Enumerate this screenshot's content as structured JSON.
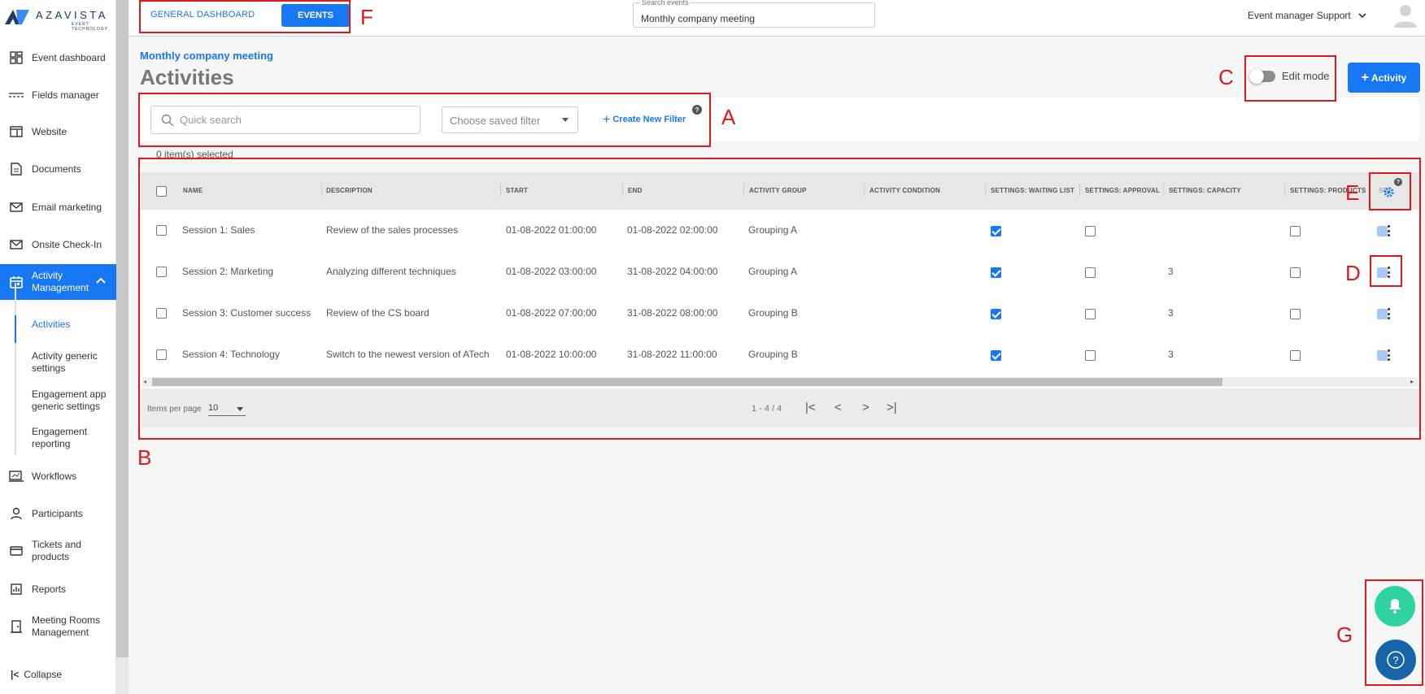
{
  "logo": {
    "name": "AZAVISTA",
    "tagline": "EVENT TECHNOLOGY"
  },
  "sidebar": {
    "items": [
      {
        "label": "Event dashboard",
        "icon": "dashboard-icon"
      },
      {
        "label": "Fields manager",
        "icon": "fields-icon"
      },
      {
        "label": "Website",
        "icon": "website-icon"
      },
      {
        "label": "Documents",
        "icon": "document-icon"
      },
      {
        "label": "Email marketing",
        "icon": "mail-icon"
      },
      {
        "label": "Onsite Check-In",
        "icon": "mail-icon"
      },
      {
        "label": "Activity Management",
        "icon": "calendar-icon",
        "active": true
      },
      {
        "label": "Workflows",
        "icon": "workflow-icon"
      },
      {
        "label": "Participants",
        "icon": "person-icon"
      },
      {
        "label": "Tickets and products",
        "icon": "ticket-icon"
      },
      {
        "label": "Reports",
        "icon": "reports-icon"
      },
      {
        "label": "Meeting Rooms Management",
        "icon": "door-icon"
      }
    ],
    "subitems": [
      {
        "label": "Activities",
        "active": true
      },
      {
        "label": "Activity generic settings"
      },
      {
        "label": "Engagement app generic settings"
      },
      {
        "label": "Engagement reporting"
      }
    ],
    "collapse_label": "Collapse"
  },
  "topbar": {
    "tab_general": "GENERAL DASHBOARD",
    "tab_events": "EVENTS",
    "search_label": "Search events",
    "search_value": "Monthly company meeting",
    "user_label": "Event manager Support"
  },
  "page": {
    "breadcrumb": "Monthly company meeting",
    "title": "Activities",
    "edit_mode_label": "Edit mode",
    "add_activity_label": "Activity"
  },
  "filter": {
    "quick_search_placeholder": "Quick search",
    "saved_filter_placeholder": "Choose saved filter",
    "create_filter_label": "Create New Filter",
    "selected_text": "0 item(s) selected"
  },
  "grid": {
    "columns": [
      "NAME",
      "DESCRIPTION",
      "START",
      "END",
      "ACTIVITY GROUP",
      "ACTIVITY CONDITION",
      "SETTINGS: WAITING LIST",
      "SETTINGS: APPROVAL",
      "SETTINGS: CAPACITY",
      "SETTINGS: PRODUCTS",
      "SET"
    ],
    "rows": [
      {
        "name": "Session 1: Sales",
        "description": "Review of the sales processes",
        "start": "01-08-2022 01:00:00",
        "end": "01-08-2022 02:00:00",
        "group": "Grouping A",
        "condition": "",
        "waiting": true,
        "approval": false,
        "capacity": "",
        "products": false
      },
      {
        "name": "Session 2: Marketing",
        "description": "Analyzing different techniques",
        "start": "01-08-2022 03:00:00",
        "end": "31-08-2022 04:00:00",
        "group": "Grouping A",
        "condition": "",
        "waiting": true,
        "approval": false,
        "capacity": "3",
        "products": false
      },
      {
        "name": "Session 3: Customer success",
        "description": "Review of the CS board",
        "start": "01-08-2022 07:00:00",
        "end": "31-08-2022 08:00:00",
        "group": "Grouping B",
        "condition": "",
        "waiting": true,
        "approval": false,
        "capacity": "3",
        "products": false
      },
      {
        "name": "Session 4: Technology",
        "description": "Switch to the newest version of ATech",
        "start": "01-08-2022 10:00:00",
        "end": "31-08-2022 11:00:00",
        "group": "Grouping B",
        "condition": "",
        "waiting": true,
        "approval": false,
        "capacity": "3",
        "products": false
      }
    ],
    "items_per_page_label": "Items per page",
    "items_per_page_value": "10",
    "page_info": "1 - 4 / 4"
  },
  "annotations": [
    "A",
    "B",
    "C",
    "D",
    "E",
    "F",
    "G"
  ],
  "colors": {
    "accent": "#1877f2",
    "annotation": "#e0191e",
    "notify_fab": "#2ed3a1",
    "help_fab": "#1565a8"
  }
}
